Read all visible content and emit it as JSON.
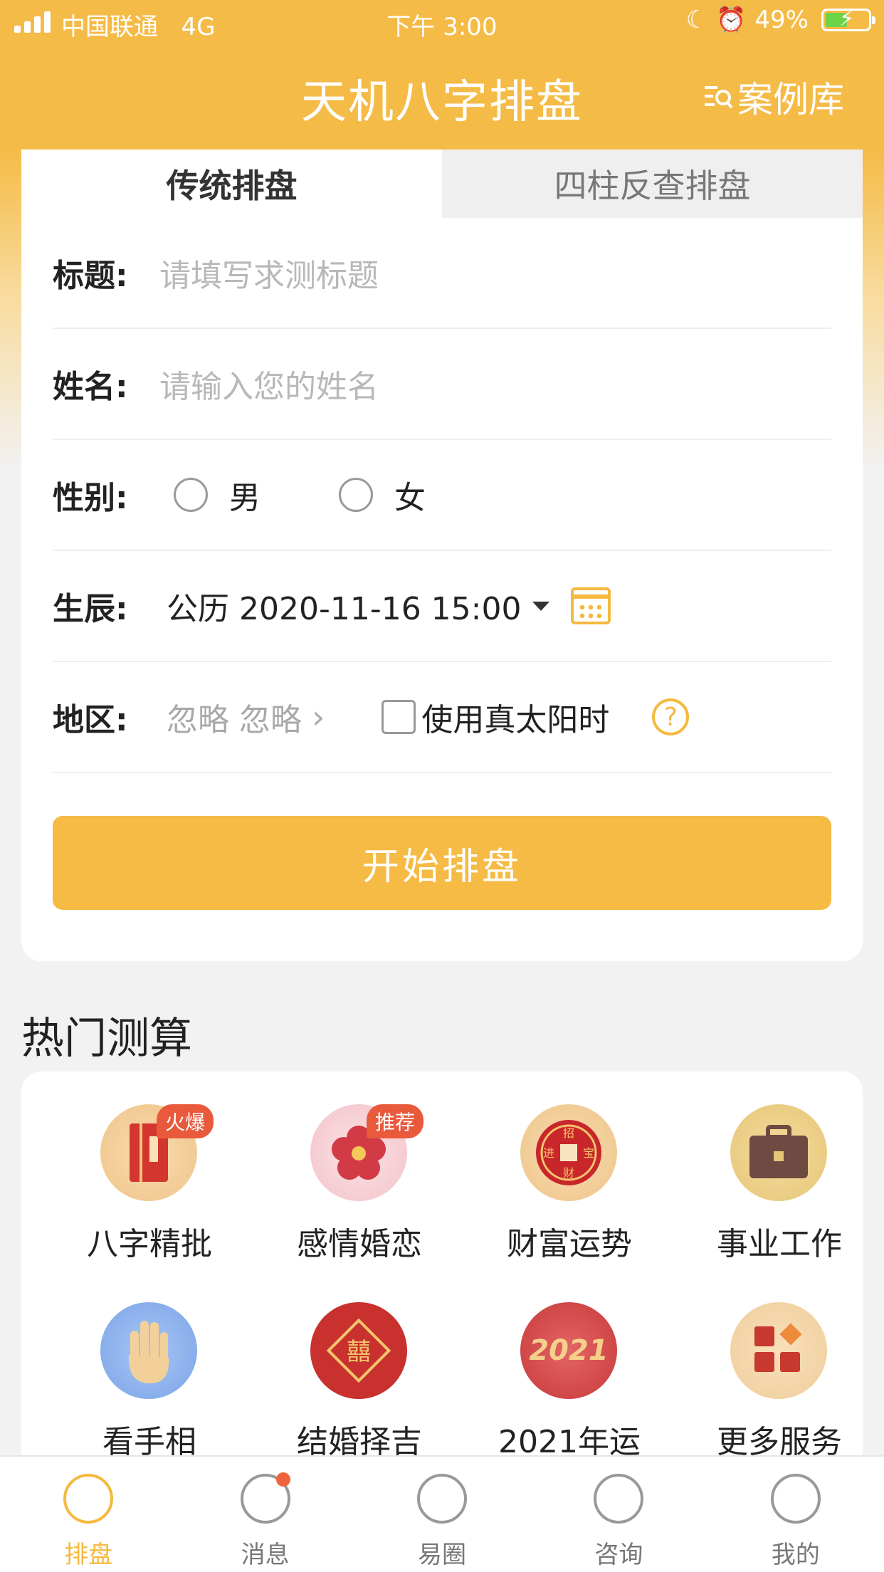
{
  "status": {
    "carrier": "中国联通",
    "network": "4G",
    "time": "下午 3:00",
    "battery": "49%"
  },
  "nav": {
    "title": "天机八字排盘",
    "case_library": "案例库"
  },
  "form": {
    "tabs": [
      "传统排盘",
      "四柱反查排盘"
    ],
    "title_label": "标题:",
    "title_placeholder": "请填写求测标题",
    "name_label": "姓名:",
    "name_placeholder": "请输入您的姓名",
    "gender_label": "性别:",
    "gender_male": "男",
    "gender_female": "女",
    "birth_label": "生辰:",
    "birth_value": "公历 2020-11-16 15:00",
    "region_label": "地区:",
    "region_value": "忽略 忽略",
    "solar_time_label": "使用真太阳时",
    "start_button": "开始排盘"
  },
  "hot": {
    "title": "热门测算",
    "items": [
      {
        "label": "八字精批",
        "badge": "火爆",
        "icon": "book-icon"
      },
      {
        "label": "感情婚恋",
        "badge": "推荐",
        "icon": "plum-blossom-icon"
      },
      {
        "label": "财富运势",
        "badge": "",
        "icon": "coin-icon"
      },
      {
        "label": "事业工作",
        "badge": "",
        "icon": "briefcase-icon"
      },
      {
        "label": "看手相",
        "badge": "",
        "icon": "palm-icon"
      },
      {
        "label": "结婚择吉",
        "badge": "",
        "icon": "double-happiness-icon"
      },
      {
        "label": "2021年运",
        "badge": "",
        "icon": "year-2021-icon"
      },
      {
        "label": "更多服务",
        "badge": "",
        "icon": "more-services-icon"
      }
    ]
  },
  "tabbar": [
    "排盘",
    "消息",
    "易圈",
    "咨询",
    "我的"
  ],
  "colors": {
    "accent": "#f5bb45",
    "badge": "#e95a3d"
  }
}
